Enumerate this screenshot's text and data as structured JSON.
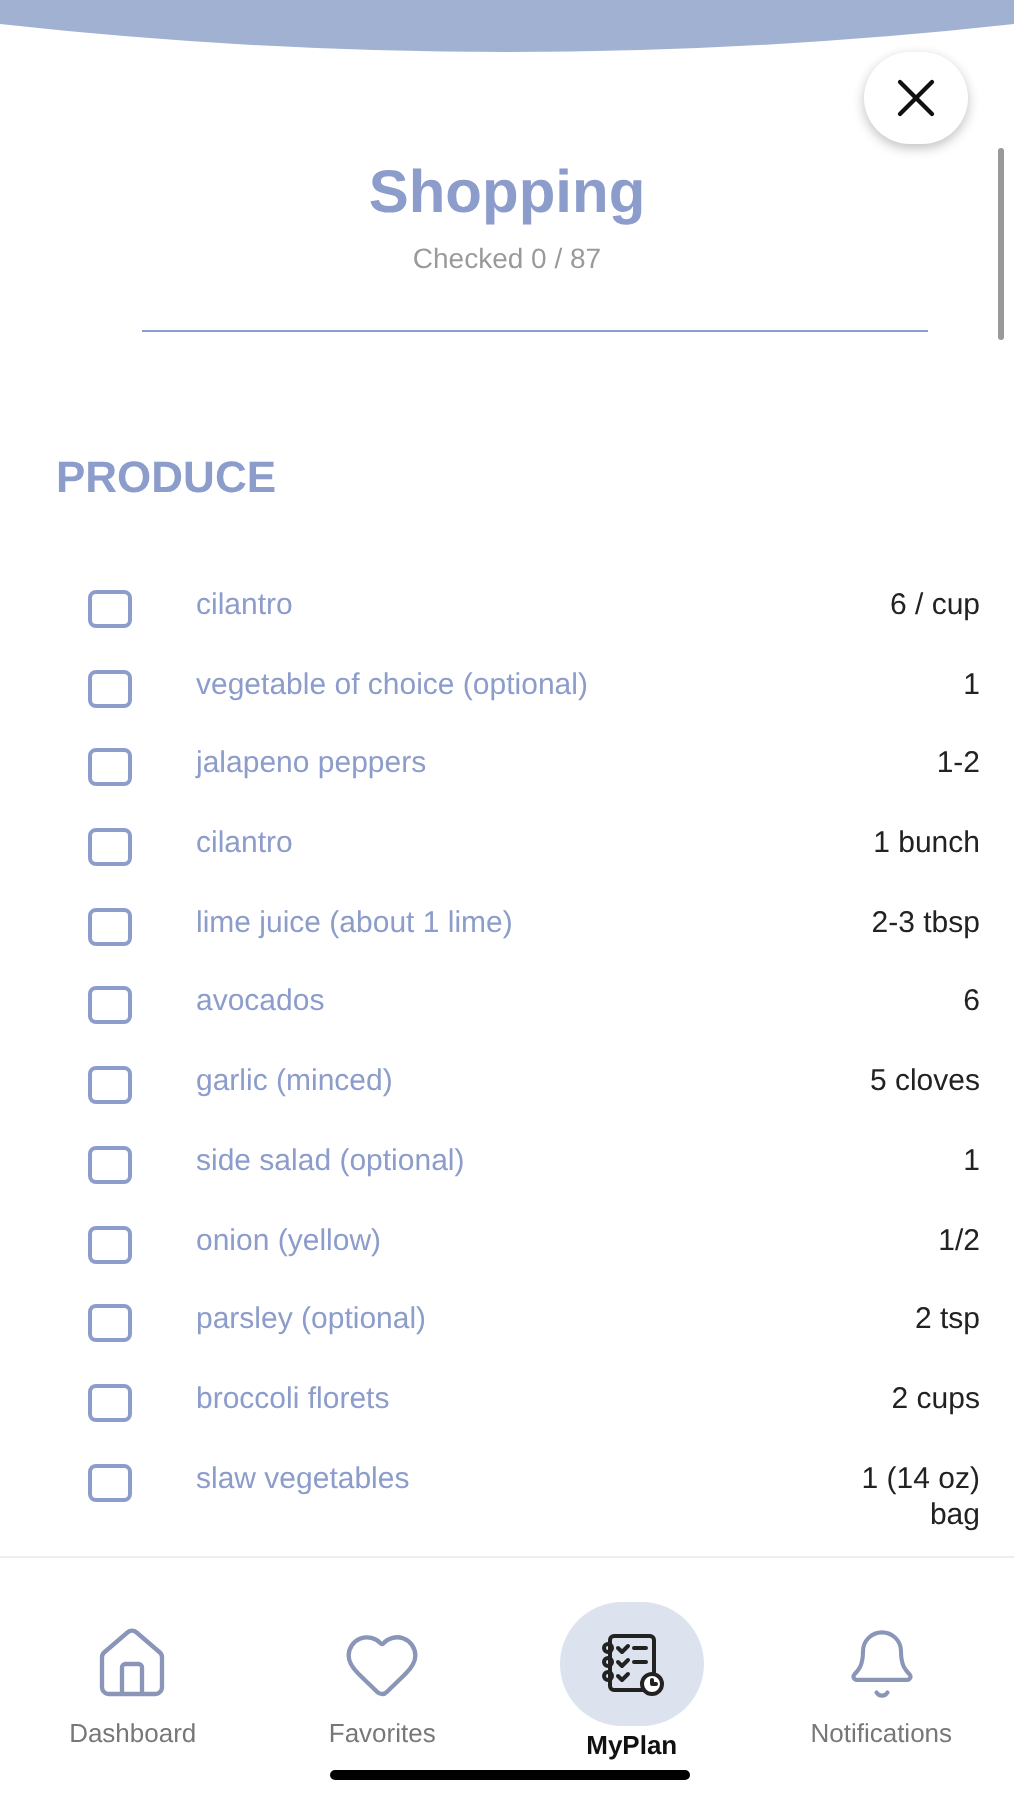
{
  "title": "Shopping",
  "subtitle": "Checked 0 / 87",
  "section": "PRODUCE",
  "items": [
    {
      "name": "cilantro",
      "qty": "6 / cup",
      "checked": false
    },
    {
      "name": "vegetable of choice (optional)",
      "qty": "1",
      "checked": false
    },
    {
      "name": "jalapeno peppers",
      "qty": "1-2",
      "checked": false
    },
    {
      "name": "cilantro",
      "qty": "1 bunch",
      "checked": false
    },
    {
      "name": "lime juice (about 1 lime)",
      "qty": "2-3 tbsp",
      "checked": false
    },
    {
      "name": "avocados",
      "qty": "6",
      "checked": false
    },
    {
      "name": "garlic (minced)",
      "qty": "5 cloves",
      "checked": false
    },
    {
      "name": "side salad (optional)",
      "qty": "1",
      "checked": false
    },
    {
      "name": "onion (yellow)",
      "qty": "1/2",
      "checked": false
    },
    {
      "name": "parsley (optional)",
      "qty": "2 tsp",
      "checked": false
    },
    {
      "name": "broccoli florets",
      "qty": "2 cups",
      "checked": false
    },
    {
      "name": "slaw vegetables",
      "qty": "1 (14 oz) bag",
      "checked": false
    }
  ],
  "nav": [
    {
      "label": "Dashboard",
      "selected": false
    },
    {
      "label": "Favorites",
      "selected": false
    },
    {
      "label": "MyPlan",
      "selected": true
    },
    {
      "label": "Notifications",
      "selected": false
    }
  ]
}
